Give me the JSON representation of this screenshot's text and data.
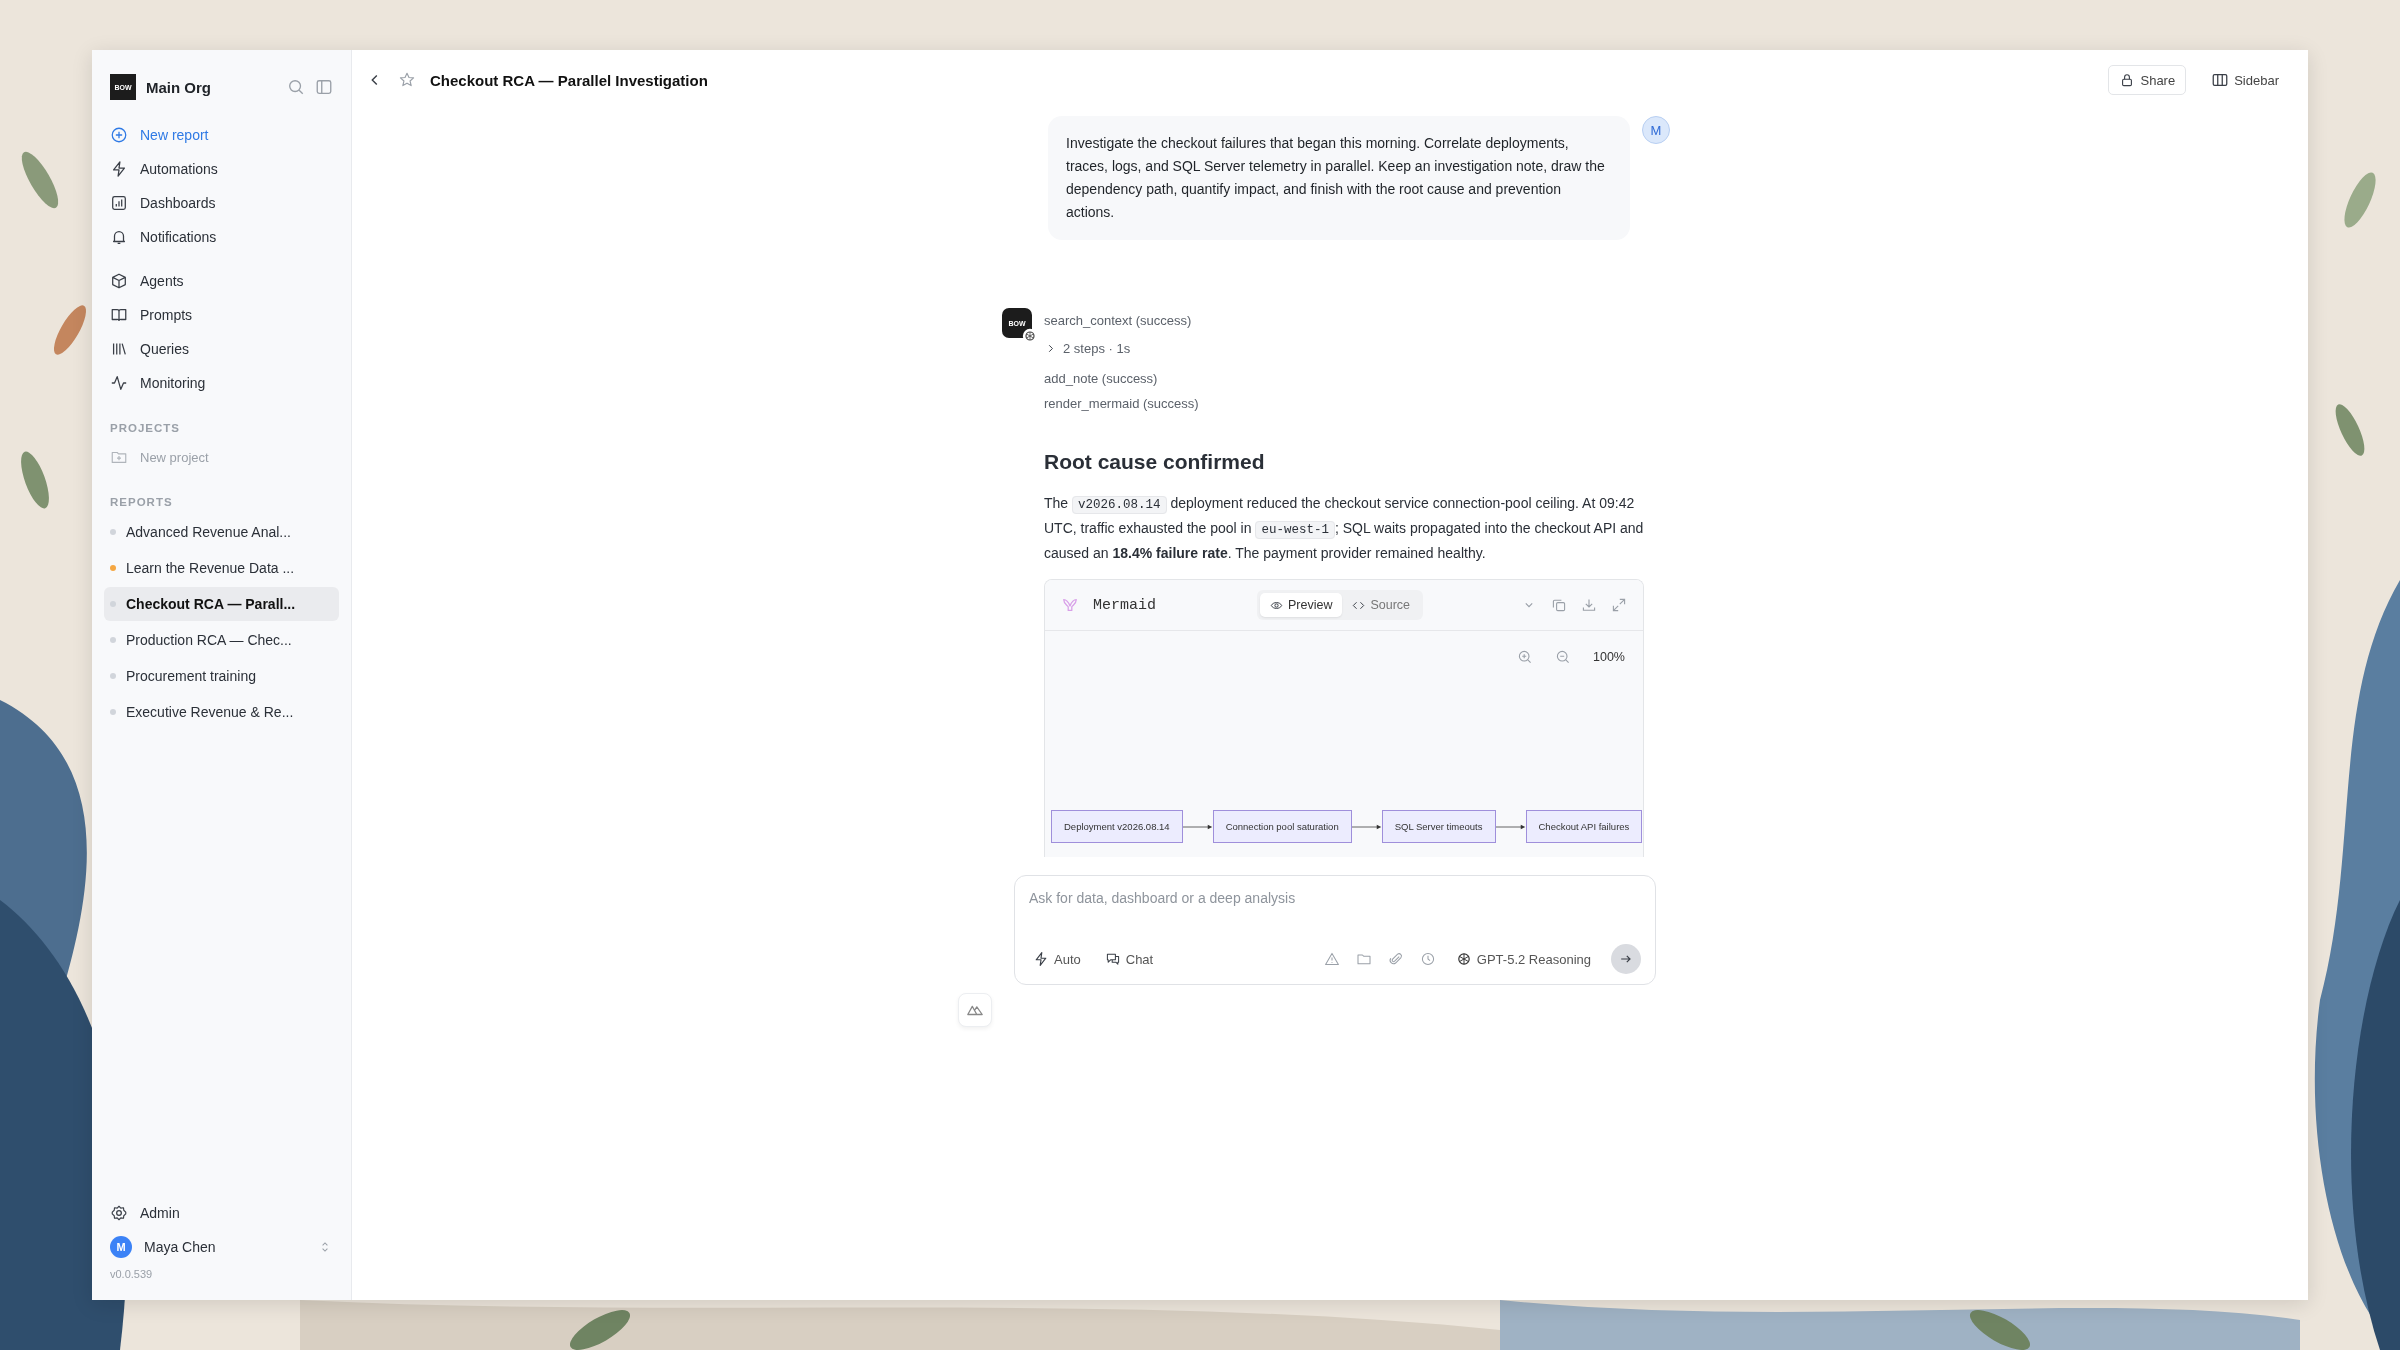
{
  "sidebar": {
    "org": {
      "logo": "BOW",
      "name": "Main Org"
    },
    "new_report": "New report",
    "nav": [
      {
        "label": "Automations"
      },
      {
        "label": "Dashboards"
      },
      {
        "label": "Notifications"
      }
    ],
    "nav2": [
      {
        "label": "Agents"
      },
      {
        "label": "Prompts"
      },
      {
        "label": "Queries"
      },
      {
        "label": "Monitoring"
      }
    ],
    "projects": {
      "heading": "PROJECTS",
      "new_project": "New project"
    },
    "reports": {
      "heading": "REPORTS",
      "items": [
        {
          "label": "Advanced Revenue Anal...",
          "color": "#d1d5db",
          "selected": false
        },
        {
          "label": "Learn the Revenue Data ...",
          "color": "#f5a742",
          "selected": false
        },
        {
          "label": "Checkout RCA — Parall...",
          "color": "#d1d5db",
          "selected": true
        },
        {
          "label": "Production RCA — Chec...",
          "color": "#d1d5db",
          "selected": false
        },
        {
          "label": "Procurement training",
          "color": "#d1d5db",
          "selected": false
        },
        {
          "label": "Executive Revenue & Re...",
          "color": "#d1d5db",
          "selected": false
        }
      ]
    },
    "admin": "Admin",
    "user": {
      "initial": "M",
      "name": "Maya Chen"
    },
    "version": "v0.0.539"
  },
  "header": {
    "title": "Checkout RCA — Parallel Investigation",
    "share": "Share",
    "sidebar": "Sidebar"
  },
  "user_message": {
    "avatar": "M",
    "text": "Investigate the checkout failures that began this morning. Correlate deployments, traces, logs, and SQL Server telemetry in parallel. Keep an investigation note, draw the dependency path, quantify impact, and finish with the root cause and prevention actions."
  },
  "assistant": {
    "avatar": "BOW",
    "steps": [
      {
        "kind": "tool",
        "text": "search_context (success)"
      },
      {
        "kind": "summary",
        "text": "2 steps · 1s"
      },
      {
        "kind": "tool",
        "text": "add_note (success)"
      },
      {
        "kind": "tool",
        "text": "render_mermaid (success)"
      }
    ],
    "heading": "Root cause confirmed",
    "paragraph": [
      {
        "kind": "text",
        "text": "The "
      },
      {
        "kind": "code",
        "text": "v2026.08.14"
      },
      {
        "kind": "text",
        "text": " deployment reduced the checkout service connection-pool ceiling. At 09:42 UTC, traffic exhausted the pool in "
      },
      {
        "kind": "code",
        "text": "eu-west-1"
      },
      {
        "kind": "text",
        "text": "; SQL waits propagated into the checkout API and caused an **18.4% failure rate**. The payment provider remained healthy."
      }
    ],
    "mermaid": {
      "title": "Mermaid",
      "tabs": [
        {
          "label": "Preview",
          "selected": true
        },
        {
          "label": "Source",
          "selected": false
        }
      ],
      "zoom": "100%",
      "nodes": [
        "Deployment v2026.08.14",
        "Connection pool saturation",
        "SQL Server timeouts",
        "Checkout API failures"
      ]
    }
  },
  "composer": {
    "placeholder": "Ask for data, dashboard or a deep analysis",
    "modes": [
      "Auto",
      "Chat"
    ],
    "model": "GPT-5.2 Reasoning",
    "send_disabled": true
  }
}
